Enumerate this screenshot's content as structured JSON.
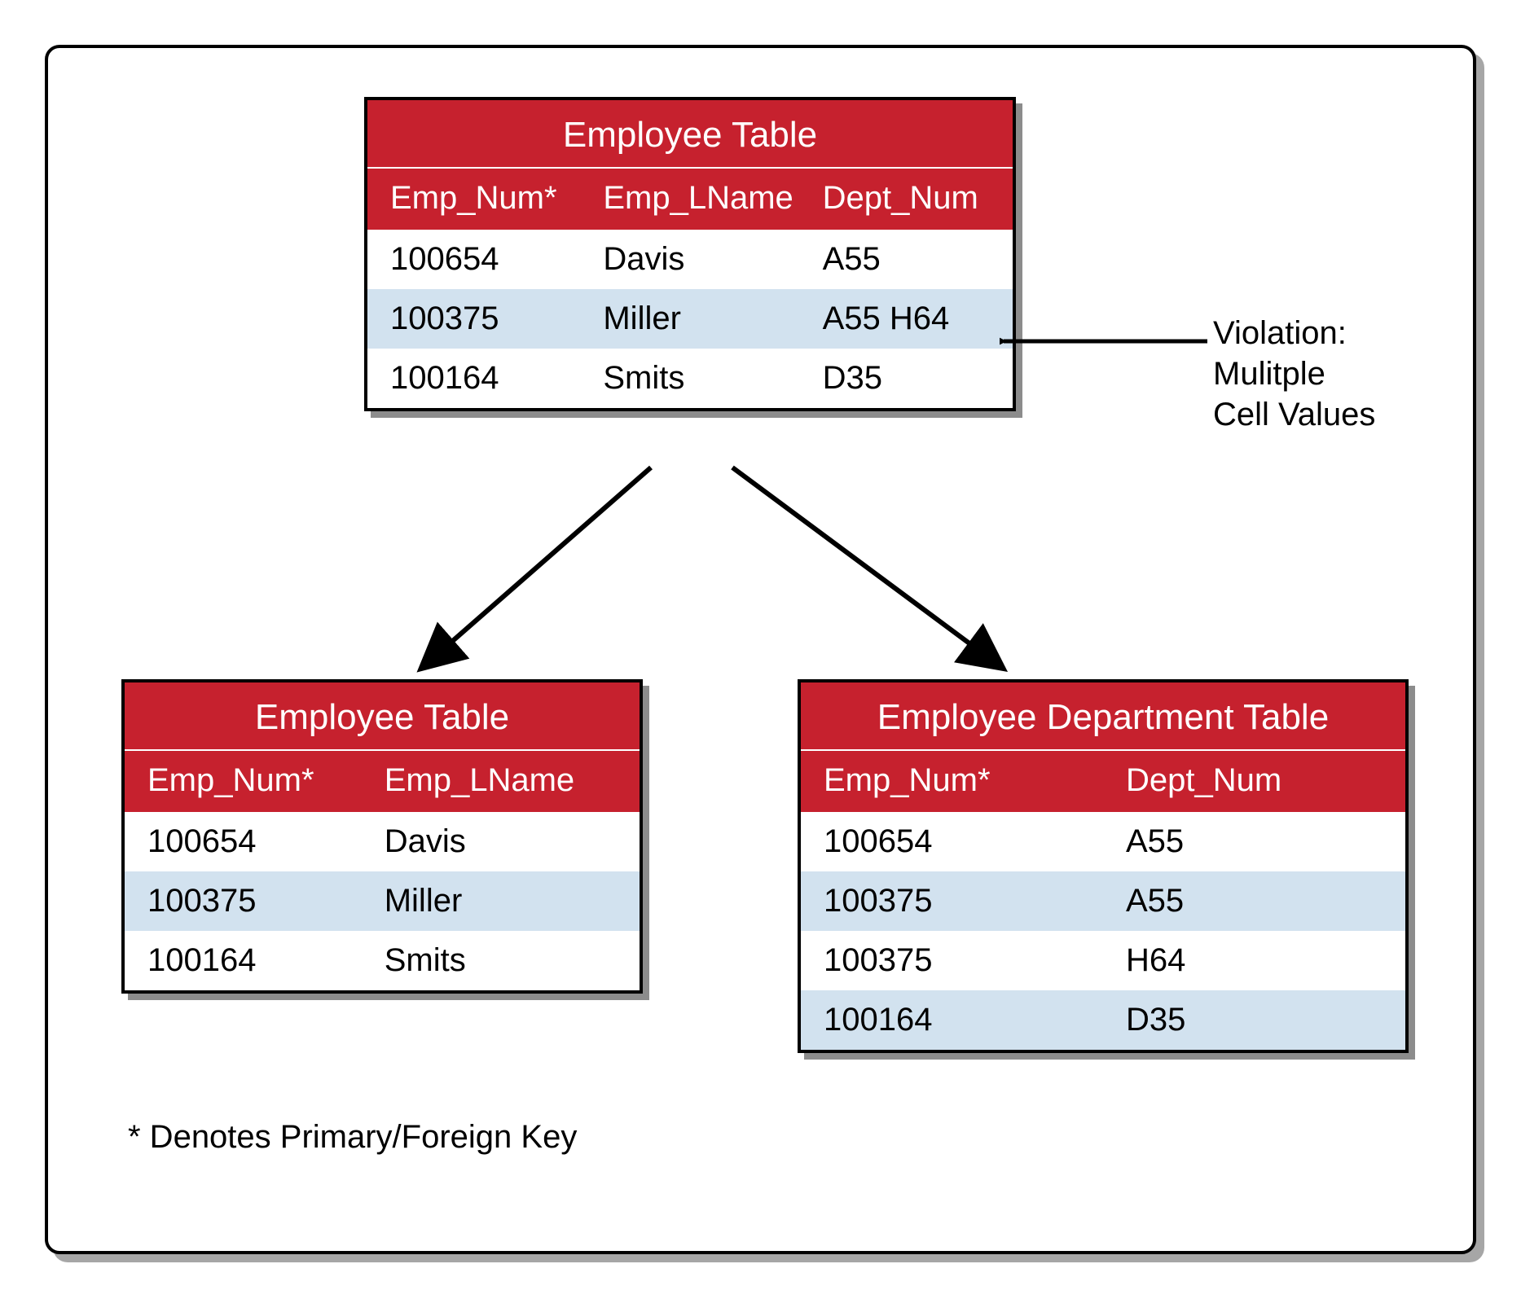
{
  "colors": {
    "accent": "#c6212e",
    "altRow": "#d2e2ef"
  },
  "topTable": {
    "title": "Employee Table",
    "headers": [
      "Emp_Num*",
      "Emp_LName",
      "Dept_Num"
    ],
    "rows": [
      {
        "cells": [
          "100654",
          "Davis",
          "A55"
        ],
        "alt": false
      },
      {
        "cells": [
          "100375",
          "Miller",
          "A55 H64"
        ],
        "alt": true
      },
      {
        "cells": [
          "100164",
          "Smits",
          "D35"
        ],
        "alt": false
      }
    ]
  },
  "bottomLeftTable": {
    "title": "Employee Table",
    "headers": [
      "Emp_Num*",
      "Emp_LName"
    ],
    "rows": [
      {
        "cells": [
          "100654",
          "Davis"
        ],
        "alt": false
      },
      {
        "cells": [
          "100375",
          "Miller"
        ],
        "alt": true
      },
      {
        "cells": [
          "100164",
          "Smits"
        ],
        "alt": false
      }
    ]
  },
  "bottomRightTable": {
    "title": "Employee Department Table",
    "headers": [
      "Emp_Num*",
      "Dept_Num"
    ],
    "rows": [
      {
        "cells": [
          "100654",
          "A55"
        ],
        "alt": false
      },
      {
        "cells": [
          "100375",
          "A55"
        ],
        "alt": true
      },
      {
        "cells": [
          "100375",
          "H64"
        ],
        "alt": false
      },
      {
        "cells": [
          "100164",
          "D35"
        ],
        "alt": true
      }
    ]
  },
  "annotation": {
    "line1": "Violation:",
    "line2": "Mulitple",
    "line3": "Cell Values"
  },
  "footnote": "* Denotes Primary/Foreign Key"
}
